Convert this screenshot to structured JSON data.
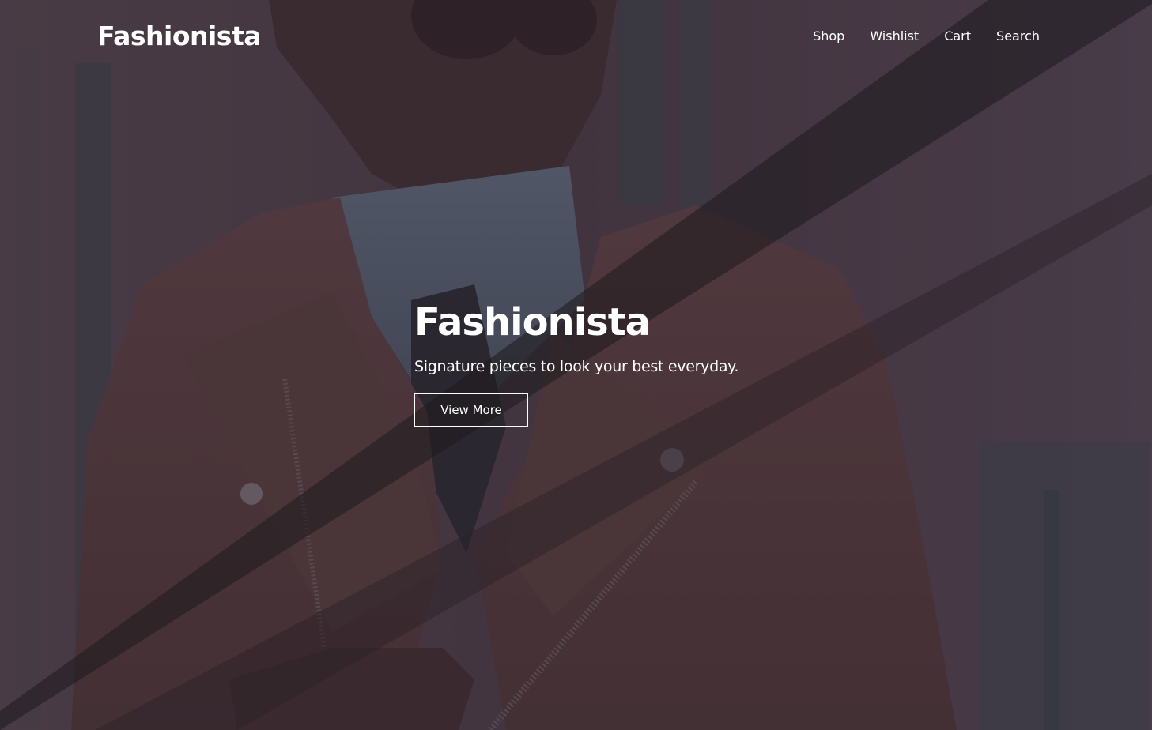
{
  "header": {
    "brand": "Fashionista",
    "nav": [
      {
        "label": "Shop"
      },
      {
        "label": "Wishlist"
      },
      {
        "label": "Cart"
      },
      {
        "label": "Search"
      }
    ]
  },
  "hero": {
    "title": "Fashionista",
    "subtitle": "Signature pieces to look your best everyday.",
    "button_label": "View More",
    "image_alt": "man-in-leather-jacket-photo"
  },
  "colors": {
    "overlay": "#3b2c37",
    "stripe_dark": "#1e1a1e",
    "text": "#ffffff"
  }
}
